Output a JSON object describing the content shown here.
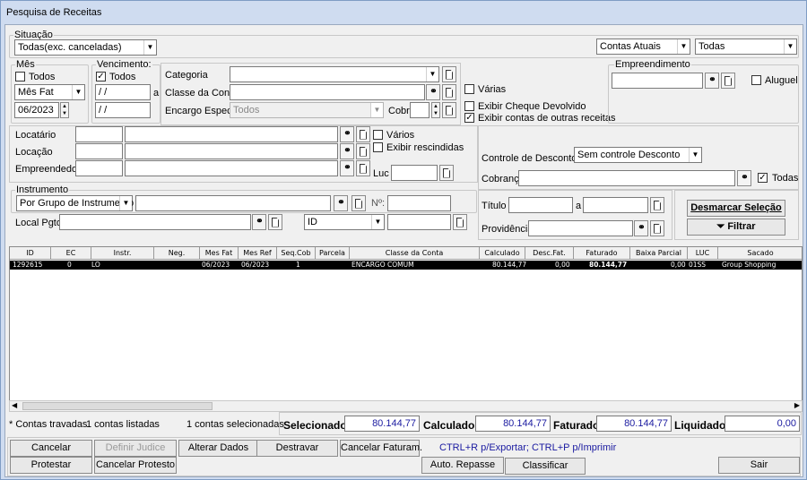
{
  "window": {
    "title": "Pesquisa de Receitas"
  },
  "situacao": {
    "label": "Situação",
    "value": "Todas(exc. canceladas)"
  },
  "contas": {
    "value": "Contas Atuais",
    "todas_value": "Todas"
  },
  "mes": {
    "label": "Mês",
    "todos_label": "Todos",
    "tipo": "Mês Fat",
    "valor": "06/2023"
  },
  "vencimento": {
    "label": "Vencimento:",
    "todos_label": "Todos",
    "de": " / /",
    "a_label": "a",
    "ate": " / /"
  },
  "categoria": {
    "label": "Categoria",
    "value": ""
  },
  "classe": {
    "label": "Classe da Conta",
    "value": ""
  },
  "encargo": {
    "label": "Encargo Espec.",
    "value": "Todos",
    "cobr_label": "Cobr"
  },
  "flags": {
    "varias": "Várias",
    "cheque_devolvido": "Exibir Cheque Devolvido",
    "outras_receitas": "Exibir contas de outras receitas"
  },
  "empreendimento": {
    "label": "Empreendimento",
    "aluguel": "Aluguel"
  },
  "locatario": {
    "label": "Locatário"
  },
  "locacao": {
    "label": "Locação",
    "varios": "Vários",
    "rescindidas": "Exibir rescindidas"
  },
  "empreendedor": {
    "label": "Empreendedor",
    "luc": "Luc"
  },
  "descontos": {
    "label": "Controle de Descontos",
    "value": "Sem controle Desconto",
    "cobranca": "Cobrança",
    "todas": "Todas"
  },
  "instrumento": {
    "label": "Instrumento",
    "value": "Por Grupo de Instrumento",
    "n_label": "Nº:"
  },
  "local": {
    "label": "Local Pgto",
    "id_value": "ID"
  },
  "titulo": {
    "label": "Título",
    "a_label": "a",
    "providencia": "Providência"
  },
  "acoes": {
    "desmarcar": "Desmarcar Seleção",
    "filtrar": "Filtrar"
  },
  "table": {
    "headers": [
      "ID",
      "EC",
      "Instr.",
      "Neg.",
      "Mes Fat",
      "Mes Ref",
      "Seq.Cob",
      "Parcela",
      "Classe da Conta",
      "Calculado",
      "Desc.Fat.",
      "Faturado",
      "Baixa Parcial",
      "LUC",
      "Sacado"
    ],
    "rows": [
      {
        "id": "1292615",
        "ec": "0",
        "instr": "LO",
        "neg": "",
        "mes_fat": "06/2023",
        "mes_ref": "06/2023",
        "seq": "1",
        "parcela": "",
        "classe": "ENCARGO COMUM",
        "calculado": "80.144,77",
        "desc": "0,00",
        "faturado": "80.144,77",
        "baixa": "0,00",
        "luc": "01SS",
        "sacado": "Group Shopping"
      }
    ]
  },
  "status": {
    "travadas": "* Contas travadas",
    "listadas": "1 contas listadas",
    "selecionadas": "1 contas selecionadas",
    "selecionado_label": "Selecionado",
    "selecionado": "80.144,77",
    "calculado_label": "Calculado",
    "calculado": "80.144,77",
    "faturado_label": "Faturado",
    "faturado": "80.144,77",
    "liquidado_label": "Liquidado",
    "liquidado": "0,00"
  },
  "buttons": {
    "cancelar": "Cancelar",
    "definir_judice": "Definir Judice",
    "alterar_dados": "Alterar Dados",
    "destravar": "Destravar",
    "cancelar_faturam": "Cancelar Faturam.",
    "hint": "CTRL+R p/Exportar; CTRL+P p/Imprimir",
    "protestar": "Protestar",
    "cancelar_protesto": "Cancelar Protesto",
    "auto_repasse": "Auto. Repasse",
    "classificar": "Classificar",
    "sair": "Sair"
  },
  "colors": {
    "hint": "#1a1aa0",
    "value_text": "#1a1aa0",
    "selection": "#000000"
  }
}
